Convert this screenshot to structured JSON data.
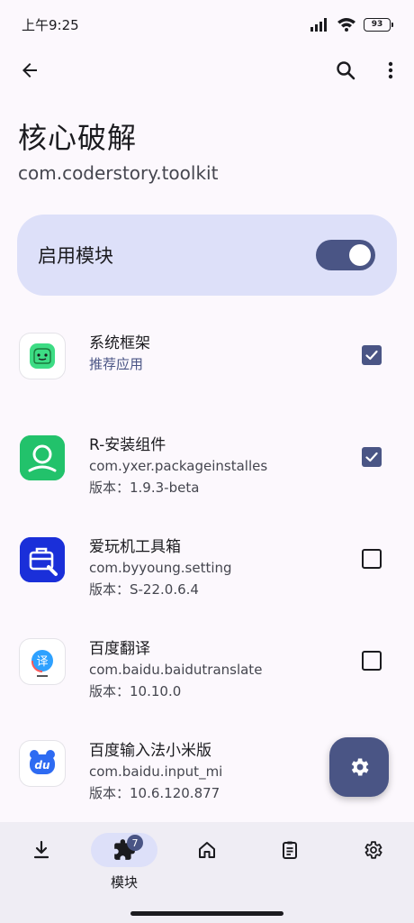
{
  "status": {
    "time": "上午9:25",
    "battery": "93"
  },
  "header": {
    "title": "核心破解",
    "package": "com.coderstory.toolkit"
  },
  "enable": {
    "label": "启用模块",
    "on": true
  },
  "apps": [
    {
      "name": "系统框架",
      "line1": "推荐应用",
      "line2": "",
      "checked": true,
      "icon": "system-framework-icon"
    },
    {
      "name": "R-安装组件",
      "line1": "com.yxer.packageinstalles",
      "line2": "版本：1.9.3-beta",
      "checked": true,
      "icon": "package-installer-icon"
    },
    {
      "name": "爱玩机工具箱",
      "line1": "com.byyoung.setting",
      "line2": "版本：S-22.0.6.4",
      "checked": false,
      "icon": "toolbox-icon"
    },
    {
      "name": "百度翻译",
      "line1": "com.baidu.baidutranslate",
      "line2": "版本：10.10.0",
      "checked": false,
      "icon": "baidu-translate-icon"
    },
    {
      "name": "百度输入法小米版",
      "line1": "com.baidu.input_mi",
      "line2": "版本：10.6.120.877",
      "checked": false,
      "icon": "baidu-input-icon"
    }
  ],
  "nav": {
    "modules_label": "模块",
    "modules_badge": "7"
  },
  "colors": {
    "accent": "#4a5585",
    "accent_container": "#dde0f9",
    "background": "#fcf8fd"
  }
}
